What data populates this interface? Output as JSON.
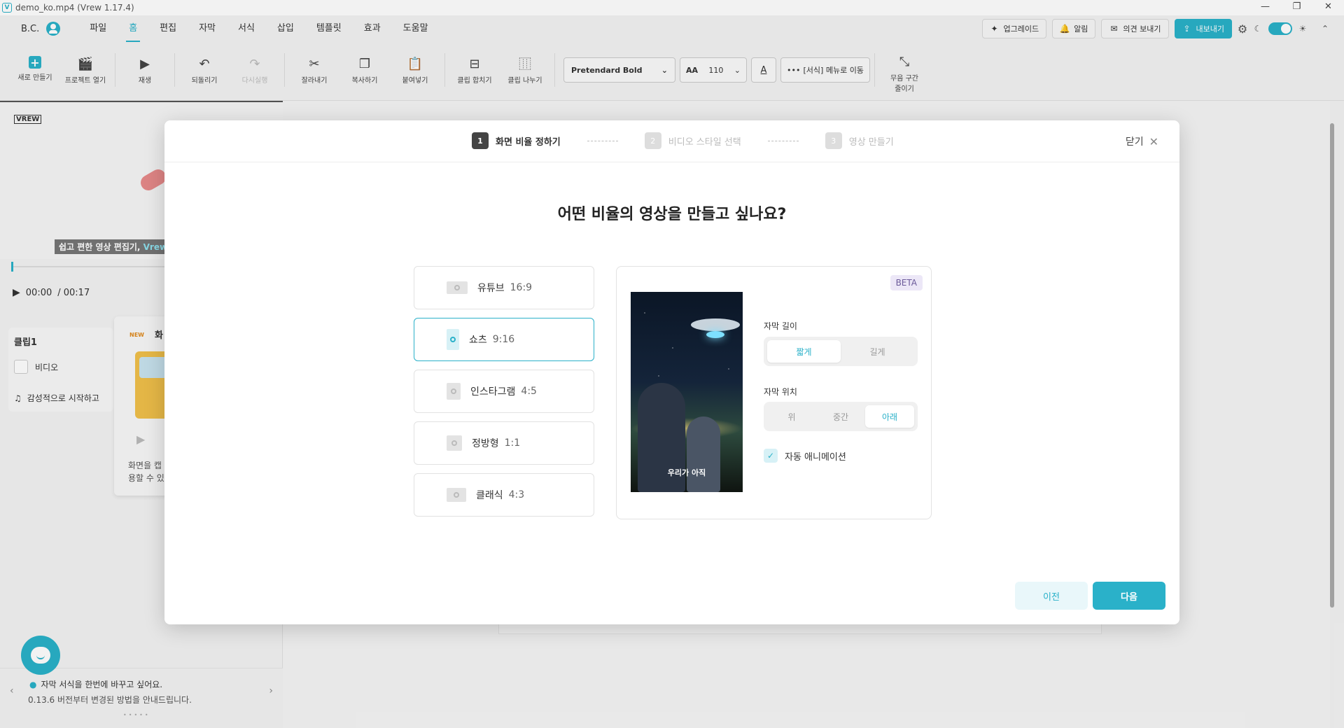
{
  "window": {
    "title": "demo_ko.mp4 (Vrew 1.17.4)",
    "controls": [
      "—",
      "❐",
      "✕"
    ]
  },
  "menubar": {
    "user": "B.C.",
    "items": [
      "파일",
      "홈",
      "편집",
      "자막",
      "서식",
      "삽입",
      "템플릿",
      "효과",
      "도움말"
    ],
    "active_index": 1,
    "upgrade": "업그레이드",
    "notifications": "알림",
    "feedback": "의견 보내기",
    "export": "내보내기"
  },
  "toolbar": {
    "new": "새로 만들기",
    "open": "프로젝트 열기",
    "play": "재생",
    "undo": "되돌리기",
    "redo": "다시실행",
    "cut": "잘라내기",
    "copy": "복사하기",
    "paste": "붙여넣기",
    "merge": "클립 합치기",
    "split": "클립 나누기",
    "font": "Pretendard Bold",
    "size": "110",
    "color_glyph": "A",
    "format_menu": "[서식] 메뉴로 이동",
    "silence_line1": "무음 구간",
    "silence_line2": "줄이기"
  },
  "left": {
    "logo": "VREW",
    "subtitle_text": "쉽고 편한 영상 편집기,",
    "subtitle_highlight": "Vrew",
    "time_current": "00:00",
    "time_total": "/ 00:17",
    "clip_title": "클립1",
    "clip_video": "비디오",
    "clip_audio": "감성적으로 시작하고",
    "new_badge": "NEW",
    "new_title": "화",
    "new_desc_line1": "화면을 캡",
    "new_desc_line2": "용할 수 있",
    "tip_line1": "자막 서식을 한번에 바꾸고 싶어요.",
    "tip_line2": "0.13.6 버전부터 변경된 방법을 안내드립니다.",
    "tip_dots": "•••••"
  },
  "modal": {
    "steps": [
      {
        "num": "1",
        "label": "화면 비율 정하기"
      },
      {
        "num": "2",
        "label": "비디오 스타일 선택"
      },
      {
        "num": "3",
        "label": "영상 만들기"
      }
    ],
    "active_step": 0,
    "close": "닫기",
    "question": "어떤 비율의 영상을 만들고 싶나요?",
    "ratios": [
      {
        "name": "유튜브",
        "value": "16:9"
      },
      {
        "name": "쇼츠",
        "value": "9:16"
      },
      {
        "name": "인스타그램",
        "value": "4:5"
      },
      {
        "name": "정방형",
        "value": "1:1"
      },
      {
        "name": "클래식",
        "value": "4:3"
      }
    ],
    "selected_ratio": 1,
    "beta": "BETA",
    "thumb_caption": "우리가 아직",
    "subtitle_length_label": "자막 길이",
    "subtitle_length_options": [
      "짧게",
      "길게"
    ],
    "subtitle_length_selected": 0,
    "subtitle_position_label": "자막 위치",
    "subtitle_position_options": [
      "위",
      "중간",
      "아래"
    ],
    "subtitle_position_selected": 2,
    "auto_animation": "자동 애니메이션",
    "auto_animation_checked": true,
    "prev": "이전",
    "next": "다음"
  },
  "colors": {
    "accent": "#2ab1c9",
    "beta_bg": "#ece7f7"
  }
}
